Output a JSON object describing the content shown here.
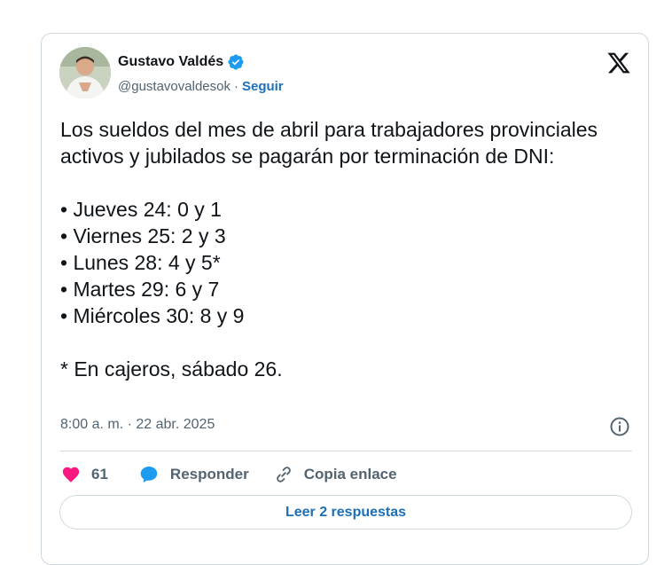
{
  "author": {
    "name": "Gustavo Valdés",
    "handle": "@gustavovaldesok",
    "separator": "·",
    "follow_label": "Seguir"
  },
  "tweet": {
    "text": "Los sueldos del mes de abril para trabajadores provinciales activos y jubilados se pagarán por terminación de DNI:\n\n• Jueves 24: 0 y 1\n• Viernes 25: 2 y 3\n• Lunes 28: 4 y 5*\n• Martes 29: 6 y 7\n• Miércoles 30: 8 y 9\n\n* En cajeros, sábado 26.",
    "timestamp": "8:00 a. m. · 22 abr. 2025"
  },
  "actions": {
    "likes_count": "61",
    "reply_label": "Responder",
    "copy_label": "Copia enlace"
  },
  "read_replies_label": "Leer 2 respuestas",
  "colors": {
    "accent": "#1d6fb8",
    "like": "#f91880",
    "verified": "#1d9bf0",
    "muted": "#536471",
    "border": "#cfd9de"
  },
  "icons": [
    "verified-badge-icon",
    "x-logo-icon",
    "info-icon",
    "heart-icon",
    "reply-bubble-icon",
    "link-icon"
  ]
}
